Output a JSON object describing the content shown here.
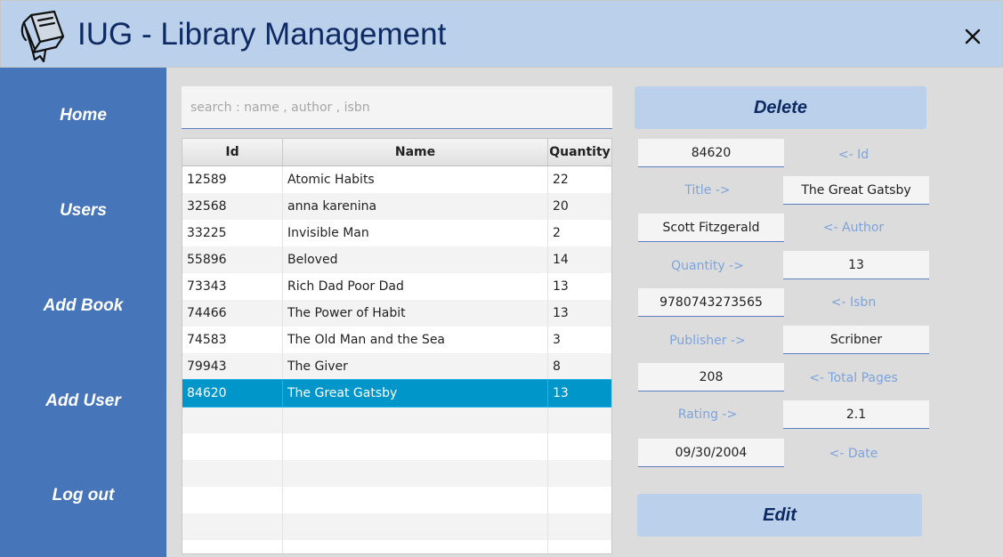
{
  "app": {
    "title": "IUG - Library Management",
    "logo_icon": "book-icon",
    "close_icon": "close-icon"
  },
  "colors": {
    "titlebar": "#bbd0eb",
    "sidebar": "#4775b9",
    "title_text": "#0e2a63",
    "selected_row": "#0096c9",
    "label_text": "#7da3dc"
  },
  "sidebar": {
    "items": [
      {
        "label": "Home"
      },
      {
        "label": "Users"
      },
      {
        "label": "Add Book"
      },
      {
        "label": "Add User"
      },
      {
        "label": "Log out"
      }
    ]
  },
  "search": {
    "placeholder": "search : name , author , isbn",
    "value": ""
  },
  "table": {
    "columns": [
      "Id",
      "Name",
      "Quantity"
    ],
    "rows": [
      [
        "12589",
        "Atomic Habits",
        "22"
      ],
      [
        "32568",
        "anna karenina",
        "20"
      ],
      [
        "33225",
        "Invisible Man",
        "2"
      ],
      [
        "55896",
        "Beloved",
        "14"
      ],
      [
        "73343",
        "Rich Dad Poor Dad",
        "13"
      ],
      [
        "74466",
        "The Power of Habit",
        "13"
      ],
      [
        "74583",
        "The Old Man and the Sea",
        "3"
      ],
      [
        "79943",
        "The Giver",
        "8"
      ],
      [
        "84620",
        "The Great Gatsby",
        "13"
      ]
    ],
    "selected_index": 8
  },
  "actions": {
    "delete_label": "Delete",
    "edit_label": "Edit"
  },
  "details": {
    "id": {
      "value": "84620",
      "label": "<- Id"
    },
    "title": {
      "value": "The Great Gatsby",
      "label": "Title ->"
    },
    "author": {
      "value": "Scott Fitzgerald",
      "label": "<- Author"
    },
    "quantity": {
      "value": "13",
      "label": "Quantity ->"
    },
    "isbn": {
      "value": "9780743273565",
      "label": "<- Isbn"
    },
    "publisher": {
      "value": "Scribner",
      "label": "Publisher ->"
    },
    "total_pages": {
      "value": "208",
      "label": "<- Total Pages"
    },
    "rating": {
      "value": "2.1",
      "label": "Rating ->"
    },
    "date": {
      "value": "09/30/2004",
      "label": "<- Date"
    }
  }
}
